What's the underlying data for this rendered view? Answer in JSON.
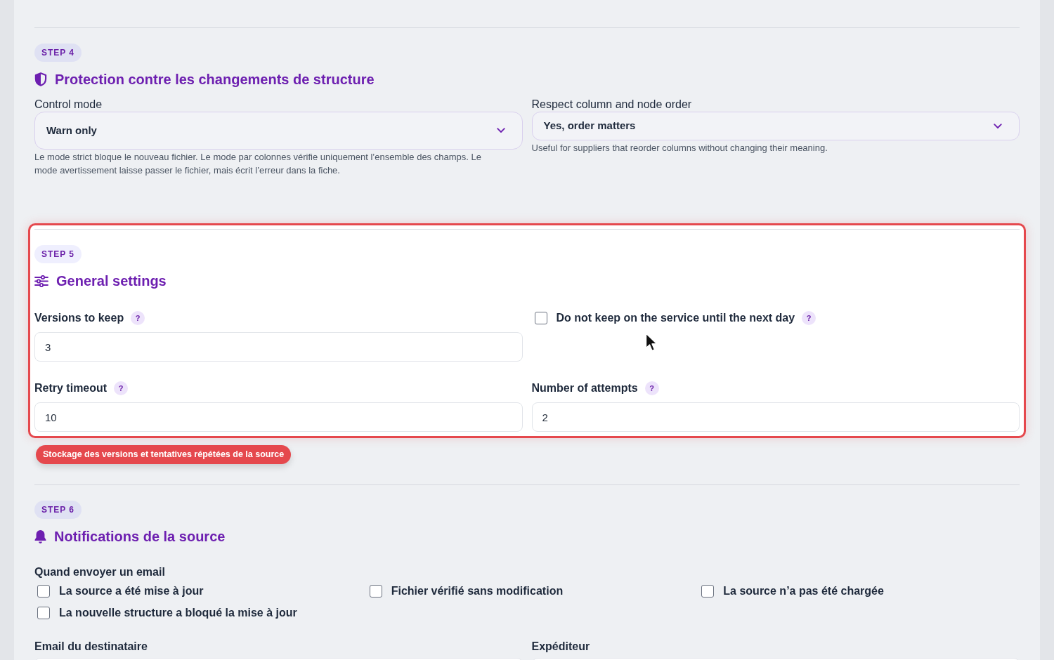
{
  "steps": [
    {
      "badge": "STEP 4",
      "title": "Protection contre les changements de structure",
      "highlighted": false,
      "fields": [
        {
          "kind": "select",
          "label": "Control mode",
          "value": "Warn only",
          "help": "Le mode strict bloque le nouveau fichier. Le mode par colonnes vérifie uniquement l’ensemble des champs. Le mode avertissement laisse passer le fichier, mais écrit l’erreur dans la fiche."
        },
        {
          "kind": "select",
          "label": "Respect column and node order",
          "value": "Yes, order matters",
          "help": "Useful for suppliers that reorder columns without changing their meaning."
        }
      ]
    },
    {
      "badge": "STEP 5",
      "title": "General settings",
      "highlighted": true,
      "callout": "Stockage des versions et tentatives répétées de la source",
      "fields": [
        {
          "kind": "input",
          "label": "Versions to keep",
          "info": "?",
          "value": "3"
        },
        {
          "kind": "checkbox",
          "label": "Do not keep on the service until the next day",
          "info": "?",
          "checked": false
        },
        {
          "kind": "input",
          "label": "Retry timeout",
          "info": "?",
          "value": "10"
        },
        {
          "kind": "input",
          "label": "Number of attempts",
          "info": "?",
          "value": "2"
        }
      ]
    },
    {
      "badge": "STEP 6",
      "title": "Notifications de la source",
      "highlighted": false,
      "fields": [
        {
          "kind": "checkgroup",
          "label": "Quand envoyer un email",
          "options": [
            {
              "label": "La source a été mise à jour",
              "checked": false
            },
            {
              "label": "Fichier vérifié sans modification",
              "checked": false
            },
            {
              "label": "La source n’a pas été chargée",
              "checked": false
            },
            {
              "label": "La nouvelle structure a bloqué la mise à jour",
              "checked": false
            }
          ]
        },
        {
          "kind": "input",
          "label": "Email du destinataire"
        },
        {
          "kind": "input",
          "label": "Expéditeur"
        }
      ]
    }
  ]
}
